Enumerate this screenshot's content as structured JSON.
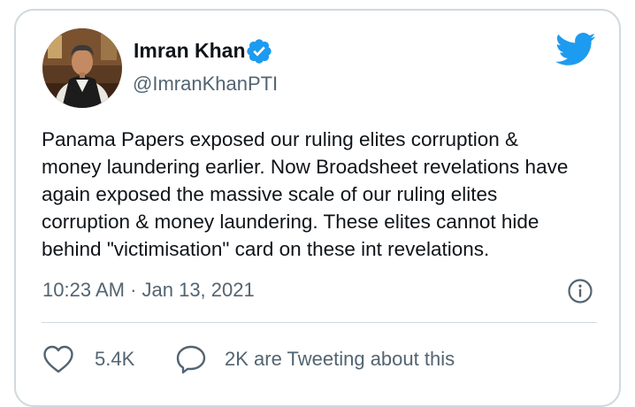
{
  "tweet": {
    "author": {
      "display_name": "Imran Khan",
      "handle": "@ImranKhanPTI",
      "verified": true,
      "avatar": "profile-photo"
    },
    "text": "Panama Papers exposed our ruling elites corruption &\nmoney laundering earlier. Now Broadsheet revelations have\nagain exposed the massive scale of our ruling elites\ncorruption & money laundering. These elites cannot hide\nbehind \"victimisation\" card on these int revelations.",
    "timestamp": "10:23 AM · Jan 13, 2021",
    "actions": {
      "likes_label": "5.4K",
      "tweeting_label": "2K are Tweeting about this"
    }
  },
  "icons": {
    "brand": "twitter-bird-icon",
    "verified": "verified-badge-icon",
    "info": "info-icon",
    "like": "heart-icon",
    "reply": "speech-bubble-icon"
  },
  "colors": {
    "brand_blue": "#1d9bf0",
    "text_primary": "#0f1419",
    "text_secondary": "#536471",
    "border": "#cfd9de"
  }
}
